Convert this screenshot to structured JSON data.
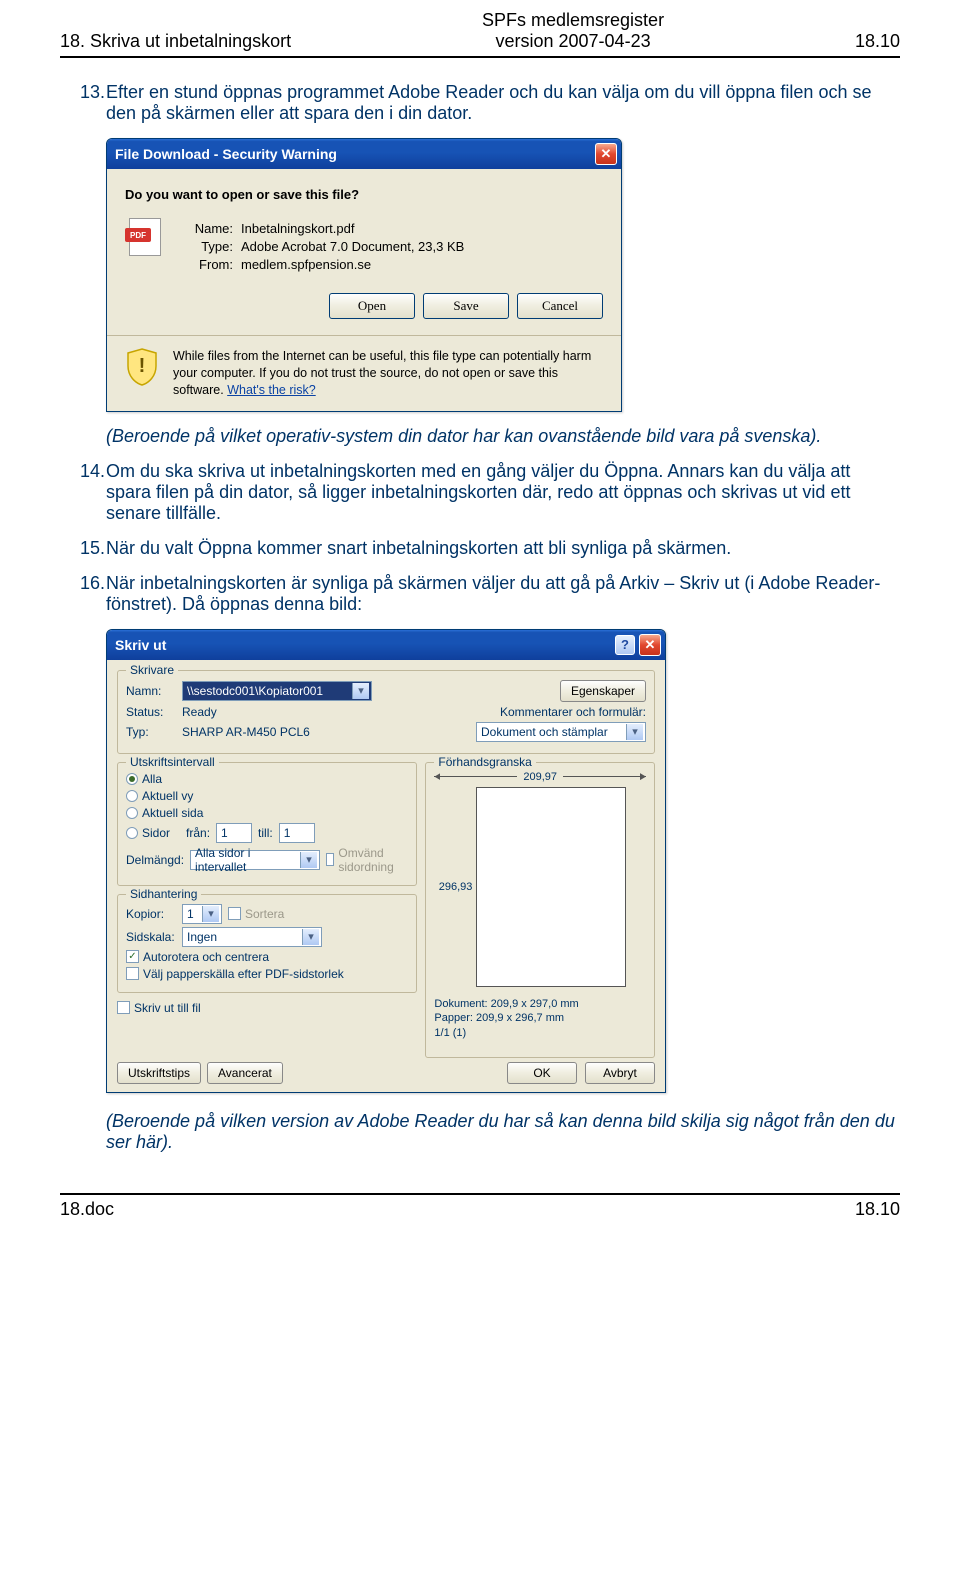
{
  "header": {
    "left": "18. Skriva ut inbetalningskort",
    "center_line1": "SPFs medlemsregister",
    "center_line2": "version 2007-04-23",
    "right": "18.10"
  },
  "para13_num": "13.",
  "para13": "Efter en stund öppnas programmet Adobe Reader och du kan välja om du vill öppna filen och se den på skärmen eller att spara den i din dator.",
  "xp_dialog": {
    "title": "File Download - Security Warning",
    "question": "Do you want to open or save this file?",
    "name_label": "Name:",
    "name_value": "Inbetalningskort.pdf",
    "type_label": "Type:",
    "type_value": "Adobe Acrobat 7.0 Document, 23,3 KB",
    "from_label": "From:",
    "from_value": "medlem.spfpension.se",
    "btn_open": "Open",
    "btn_save": "Save",
    "btn_cancel": "Cancel",
    "warn_text_1": "While files from the Internet can be useful, this file type can potentially harm your computer. If you do not trust the source, do not open or save this software. ",
    "warn_link": "What's the risk?",
    "pdf_badge": "PDF"
  },
  "note_os": "(Beroende på vilket operativ-system din dator har kan ovanstående bild vara på svenska).",
  "para14_num": "14.",
  "para14": "Om du ska skriva ut inbetalningskorten med en gång väljer du Öppna. Annars kan du välja att spara filen på din dator, så ligger inbetalningskorten där, redo att öppnas och skrivas ut vid ett senare tillfälle.",
  "para15_num": "15.",
  "para15": "När du valt Öppna kommer snart inbetalningskorten att bli synliga på skärmen.",
  "para16_num": "16.",
  "para16": "När inbetalningskorten är synliga på skärmen väljer du att gå på Arkiv – Skriv ut (i Adobe Reader-fönstret). Då öppnas denna bild:",
  "print": {
    "title": "Skriv ut",
    "group_printer": "Skrivare",
    "name_label": "Namn:",
    "name_value": "\\\\sestodc001\\Kopiator001",
    "status_label": "Status:",
    "status_value": "Ready",
    "type_label": "Typ:",
    "type_value": "SHARP AR-M450 PCL6",
    "btn_props": "Egenskaper",
    "comments_label": "Kommentarer och formulär:",
    "comments_value": "Dokument och stämplar",
    "group_range": "Utskriftsintervall",
    "opt_all": "Alla",
    "opt_view": "Aktuell vy",
    "opt_page": "Aktuell sida",
    "opt_pages": "Sidor",
    "from_label": "från:",
    "from_value": "1",
    "to_label": "till:",
    "to_value": "1",
    "subset_label": "Delmängd:",
    "subset_value": "Alla sidor i intervallet",
    "reverse": "Omvänd sidordning",
    "group_handling": "Sidhantering",
    "copies_label": "Kopior:",
    "copies_value": "1",
    "collate": "Sortera",
    "scale_label": "Sidskala:",
    "scale_value": "Ingen",
    "auto_rotate": "Autorotera och centrera",
    "paper_source": "Välj papperskälla efter PDF-sidstorlek",
    "print_to_file": "Skriv ut till fil",
    "group_preview": "Förhandsgranska",
    "preview_w": "209,97",
    "preview_h": "296,93",
    "doc_size_label": "Dokument:",
    "doc_size_value": "209,9 x 297,0 mm",
    "paper_size_label": "Papper:",
    "paper_size_value": "209,9 x 296,7 mm",
    "page_of": "1/1 (1)",
    "btn_tips": "Utskriftstips",
    "btn_adv": "Avancerat",
    "btn_ok": "OK",
    "btn_cancel": "Avbryt"
  },
  "note_version": "(Beroende på vilken version av Adobe Reader du har så kan denna bild skilja sig något från den du ser här).",
  "footer": {
    "left": "18.doc",
    "right": "18.10"
  }
}
